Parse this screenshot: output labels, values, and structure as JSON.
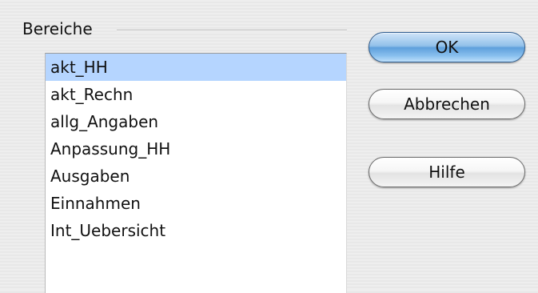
{
  "group": {
    "title": "Bereiche"
  },
  "list": {
    "items": [
      {
        "label": "akt_HH",
        "selected": true
      },
      {
        "label": "akt_Rechn",
        "selected": false
      },
      {
        "label": "allg_Angaben",
        "selected": false
      },
      {
        "label": "Anpassung_HH",
        "selected": false
      },
      {
        "label": "Ausgaben",
        "selected": false
      },
      {
        "label": "Einnahmen",
        "selected": false
      },
      {
        "label": "Int_Uebersicht",
        "selected": false
      }
    ],
    "selection_color": "#b5d5ff"
  },
  "buttons": {
    "ok_label": "OK",
    "cancel_label": "Abbrechen",
    "help_label": "Hilfe",
    "default_color": "#5fa0dc"
  }
}
